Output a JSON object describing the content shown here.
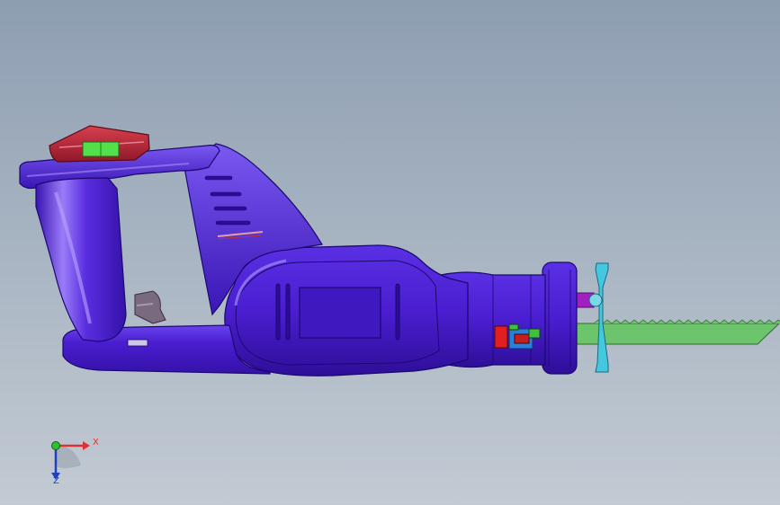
{
  "viewport": {
    "background_top": "#8e9eb2",
    "background_bottom": "#c2cad3"
  },
  "model": {
    "body_color": "#4a1ed0",
    "body_highlight": "#8f6cf5",
    "blade_color": "#6cc46c",
    "clamp_color": "#43c8e0",
    "battery_cap_color": "#c8283c",
    "level_color": "#54e04a",
    "component_colors": [
      "#e02020",
      "#2a7fd8",
      "#40c040",
      "#a020c0",
      "#7a6a80"
    ]
  },
  "triad": {
    "x_label": "X",
    "z_label": "Z",
    "x_color": "#e03030",
    "y_color": "#30c030",
    "z_color": "#2040c0"
  }
}
